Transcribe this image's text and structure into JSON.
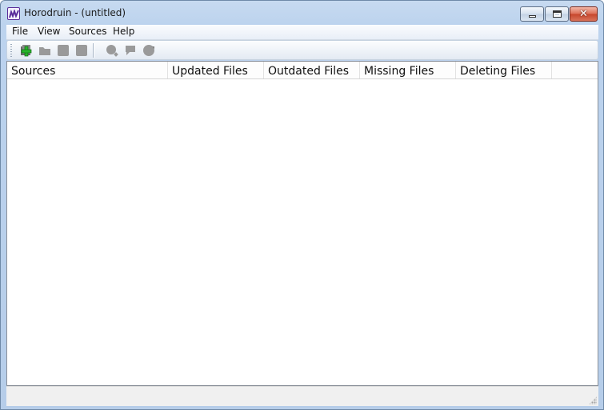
{
  "window": {
    "title": "Horodruin - (untitled)",
    "icon": "horodruin-app-icon",
    "caption_buttons": [
      "minimize",
      "maximize",
      "close"
    ]
  },
  "menu": {
    "items": [
      "File",
      "View",
      "Sources",
      "Help"
    ]
  },
  "toolbar": {
    "buttons": [
      {
        "icon": "add-source-icon",
        "enabled": true
      },
      {
        "icon": "open-folder-icon",
        "enabled": false
      },
      {
        "icon": "save-icon",
        "enabled": false
      },
      {
        "icon": "save-as-icon",
        "enabled": false
      },
      {
        "icon": "find-icon",
        "enabled": false
      },
      {
        "icon": "comment-icon",
        "enabled": false
      },
      {
        "icon": "refresh-icon",
        "enabled": false
      }
    ],
    "colors": {
      "enabled_green": "#29b42b",
      "disabled_gray": "#9a9a9a"
    }
  },
  "table": {
    "columns": [
      "Sources",
      "Updated Files",
      "Outdated Files",
      "Missing Files",
      "Deleting Files"
    ],
    "rows": []
  },
  "statusbar": {
    "text": ""
  }
}
